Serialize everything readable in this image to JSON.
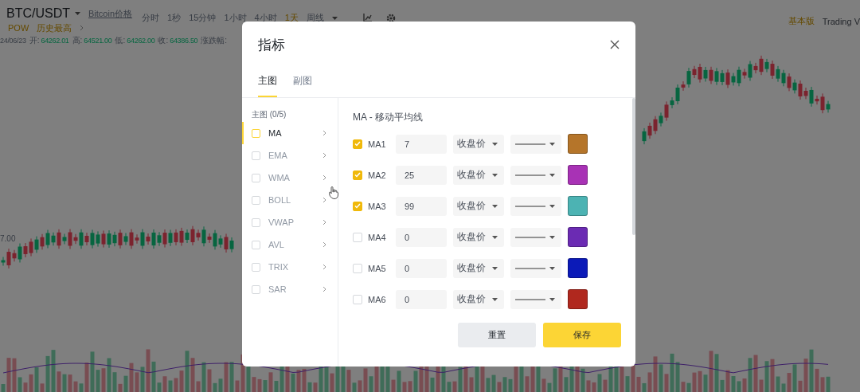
{
  "market": {
    "symbol": "BTC/USDT",
    "price_link": "Bitcoin价格",
    "tags": [
      "POW",
      "历史最高"
    ],
    "intervals": [
      {
        "label": "分时",
        "selected": false
      },
      {
        "label": "1秒",
        "selected": false
      },
      {
        "label": "15分钟",
        "selected": false
      },
      {
        "label": "1小时",
        "selected": false
      },
      {
        "label": "4小时",
        "selected": false
      },
      {
        "label": "1天",
        "selected": true
      },
      {
        "label": "周线",
        "selected": false
      }
    ],
    "date": "24/06/23",
    "ohlc": [
      {
        "label": "开:",
        "value": "64262.01"
      },
      {
        "label": "高:",
        "value": "64521.00"
      },
      {
        "label": "低:",
        "value": "64262.00"
      },
      {
        "label": "收:",
        "value": "64386.50"
      }
    ],
    "change_label": "涨跌幅:",
    "views": [
      {
        "label": "基本版",
        "selected": true
      },
      {
        "label": "Trading V",
        "selected": false
      }
    ],
    "axis_label": "7.00"
  },
  "dialog": {
    "title": "指标",
    "tabs": [
      {
        "label": "主图",
        "selected": true
      },
      {
        "label": "副图",
        "selected": false
      }
    ],
    "list_header": "主图 (0/5)",
    "indicators": [
      {
        "label": "MA",
        "selected": true,
        "checked": false
      },
      {
        "label": "EMA",
        "selected": false,
        "checked": false
      },
      {
        "label": "WMA",
        "selected": false,
        "checked": false
      },
      {
        "label": "BOLL",
        "selected": false,
        "checked": false
      },
      {
        "label": "VWAP",
        "selected": false,
        "checked": false
      },
      {
        "label": "AVL",
        "selected": false,
        "checked": false
      },
      {
        "label": "TRIX",
        "selected": false,
        "checked": false
      },
      {
        "label": "SAR",
        "selected": false,
        "checked": false
      }
    ],
    "heading": "MA - 移动平均线",
    "lines": [
      {
        "name": "MA1",
        "checked": true,
        "period": "7",
        "source": "收盘价",
        "color": "#b5752a"
      },
      {
        "name": "MA2",
        "checked": true,
        "period": "25",
        "source": "收盘价",
        "color": "#a832b5"
      },
      {
        "name": "MA3",
        "checked": true,
        "period": "99",
        "source": "收盘价",
        "color": "#4cb3b3"
      },
      {
        "name": "MA4",
        "checked": false,
        "period": "0",
        "source": "收盘价",
        "color": "#6b2bb3"
      },
      {
        "name": "MA5",
        "checked": false,
        "period": "0",
        "source": "收盘价",
        "color": "#0b1ab8"
      },
      {
        "name": "MA6",
        "checked": false,
        "period": "0",
        "source": "收盘价",
        "color": "#b0281e"
      }
    ],
    "buttons": [
      {
        "label": "重置",
        "kind": "secondary"
      },
      {
        "label": "保存",
        "kind": "primary"
      }
    ]
  }
}
